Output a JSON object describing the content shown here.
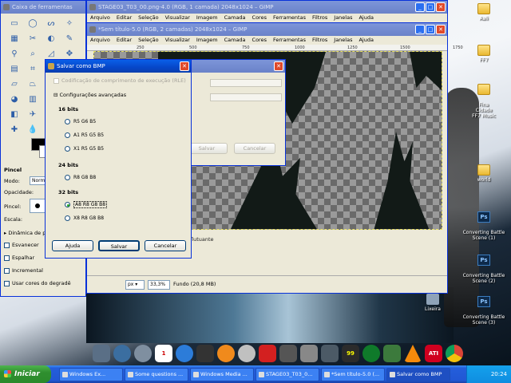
{
  "toolbox": {
    "title": "Caixa de ferramentas",
    "section_title": "Pincel",
    "mode_label": "Modo:",
    "mode_value": "Norma",
    "opacity_label": "Opacidade:",
    "brush_label": "Pincel:",
    "scale_label": "Escala:",
    "dynamics_label": "Dinâmica de p",
    "fade_label": "Esvanecer",
    "jitter_label": "Espalhar",
    "incremental_label": "Incremental",
    "gradient_label": "Usar cores do degradê"
  },
  "gimp_back": {
    "title": "STAGE03_T03_00.png-4.0 (RGB, 1 camada) 2048x1024 – GIMP",
    "menu": [
      "Arquivo",
      "Editar",
      "Seleção",
      "Visualizar",
      "Imagem",
      "Camada",
      "Cores",
      "Ferramentas",
      "Filtros",
      "Janelas",
      "Ajuda"
    ]
  },
  "gimp_front": {
    "title": "*Sem título-5.0 (RGB, 2 camadas) 2048x1024 – GIMP",
    "menu": [
      "Arquivo",
      "Editar",
      "Seleção",
      "Visualizar",
      "Imagem",
      "Camada",
      "Cores",
      "Ferramentas",
      "Filtros",
      "Janelas",
      "Ajuda"
    ],
    "ruler": [
      "250",
      "500",
      "750",
      "1000",
      "1250",
      "1500",
      "1750"
    ],
    "floating_label": "flutuante",
    "unit": "px",
    "zoom": "33,3%",
    "status": "Fundo (20,8 MB)"
  },
  "back_dialog": {
    "save_label": "Salvar",
    "cancel_label": "Cancelar"
  },
  "bmp_dialog": {
    "title": "Salvar como BMP",
    "rle_label": "Codificação de comprimento de execução (RLE)",
    "advanced_label": "Configurações avançadas",
    "groups": [
      {
        "name": "16 bits",
        "options": [
          "R5 G6 B5",
          "A1 R5 G5 B5",
          "X1 R5 G5 B5"
        ]
      },
      {
        "name": "24 bits",
        "options": [
          "R8 G8 B8"
        ]
      },
      {
        "name": "32 bits",
        "options": [
          "A8 R8 G8 B8",
          "X8 R8 G8 B8"
        ]
      }
    ],
    "selected_option": "A8 R8 G8 B8",
    "help_label": "Ajuda",
    "save_label": "Salvar",
    "cancel_label": "Cancelar"
  },
  "desktop_icons": [
    {
      "label": "Aali",
      "icon": "folder-icon"
    },
    {
      "label": "FF7",
      "icon": "folder-icon"
    },
    {
      "label": "Fina\nCidade\nFF7 Music",
      "icon": "folder-icon"
    },
    {
      "label": "world",
      "icon": "folder-icon"
    },
    {
      "label": "Converting Battle\nScene (1)",
      "icon": "psd-icon"
    },
    {
      "label": "Converting Battle\nScene (2)",
      "icon": "psd-icon"
    },
    {
      "label": "Lixeira",
      "icon": "recycle-bin-icon"
    },
    {
      "label": "Converting Battle\nScene (3)",
      "icon": "psd-icon"
    }
  ],
  "dock": [
    "1",
    "99",
    "ATI"
  ],
  "taskbar": {
    "start_label": "Iniciar",
    "tasks": [
      "Windows Ex...",
      "Some questions ...",
      "Windows Media ...",
      "STAGE03_T03_0...",
      "*Sem título-5.0 (...",
      "Salvar como BMP"
    ],
    "active_task": "Salvar como BMP",
    "clock": "20:24"
  },
  "colors": {
    "xp_blue": "#0a5fe8",
    "xp_green": "#2f8f2f",
    "dialog_bg": "#ece9d8"
  }
}
